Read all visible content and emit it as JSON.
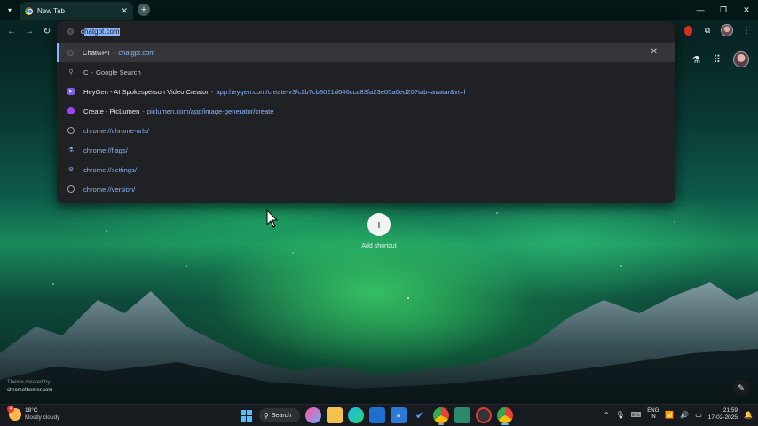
{
  "browser": {
    "tab": {
      "title": "New Tab",
      "close": "✕"
    },
    "window_controls": [
      "—",
      "❐",
      "✕"
    ]
  },
  "omnibox": {
    "typed": "c",
    "autocomplete": "hatgpt.com",
    "suggestions": [
      {
        "icon": "site-icon",
        "main": "ChatGPT",
        "sep": "-",
        "url": "chatgpt.com",
        "remove": "✕",
        "highlighted": true
      },
      {
        "icon": "search-icon",
        "main": "C",
        "sep": "-",
        "plain": "Google Search"
      },
      {
        "icon": "heygen-icon",
        "main": "HeyGen - AI Spokesperson Video Creator",
        "sep": "-",
        "url": "app.heygen.com/create-v3/c2b7cb8021d646cca83fa23e05a0ed20?tab=avatar&vt=l"
      },
      {
        "icon": "piclumen-icon",
        "main": "Create - PicLumen",
        "sep": "-",
        "url": "piclumen.com/app/image-generator/create"
      },
      {
        "icon": "globe-icon",
        "link": "chrome://chrome-urls/"
      },
      {
        "icon": "flask-icon",
        "link": "chrome://flags/"
      },
      {
        "icon": "gear-icon",
        "link": "chrome://settings/"
      },
      {
        "icon": "globe-icon",
        "link": "chrome://version/"
      }
    ]
  },
  "ntp": {
    "add_shortcut": "Add shortcut",
    "theme_credit_line1": "Theme created by",
    "theme_credit_line2": "chromethemer.com"
  },
  "taskbar": {
    "weather": {
      "badge": "4",
      "temp": "18°C",
      "condition": "Mostly cloudy"
    },
    "search_label": "Search",
    "language": {
      "line1": "ENG",
      "line2": "IN"
    },
    "clock": {
      "time": "21:59",
      "date": "17-02-2025"
    }
  },
  "colors": {
    "omnibox_bg": "#202124",
    "link": "#8ab4f8",
    "highlight_row": "#35363a"
  }
}
